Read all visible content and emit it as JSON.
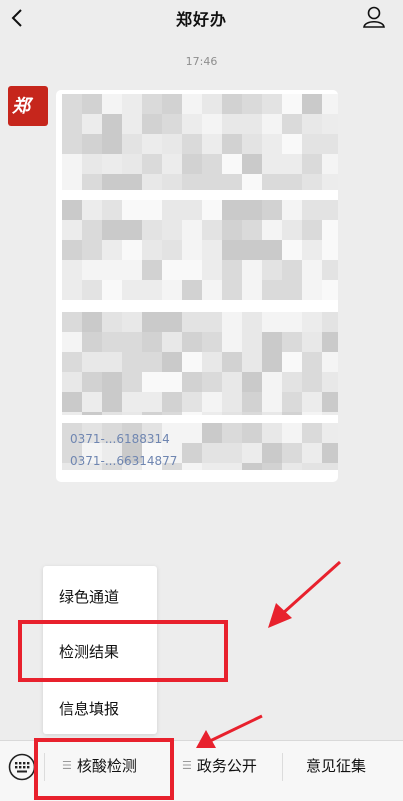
{
  "header": {
    "title": "郑好办",
    "back_icon": "chevron-left-icon",
    "profile_icon": "person-icon"
  },
  "chat": {
    "timestamp": "17:46",
    "avatar_text": "郑",
    "message_footer_lines": [
      "0371-...6188314",
      "0371-...66314877"
    ]
  },
  "popup_menu": {
    "items": [
      "绿色通道",
      "检测结果",
      "信息填报"
    ]
  },
  "bottom_bar": {
    "keyboard_icon": "keyboard-icon",
    "tabs": [
      "核酸检测",
      "政务公开",
      "意见征集"
    ]
  },
  "annotations": {
    "highlight_color": "#e8212d"
  }
}
